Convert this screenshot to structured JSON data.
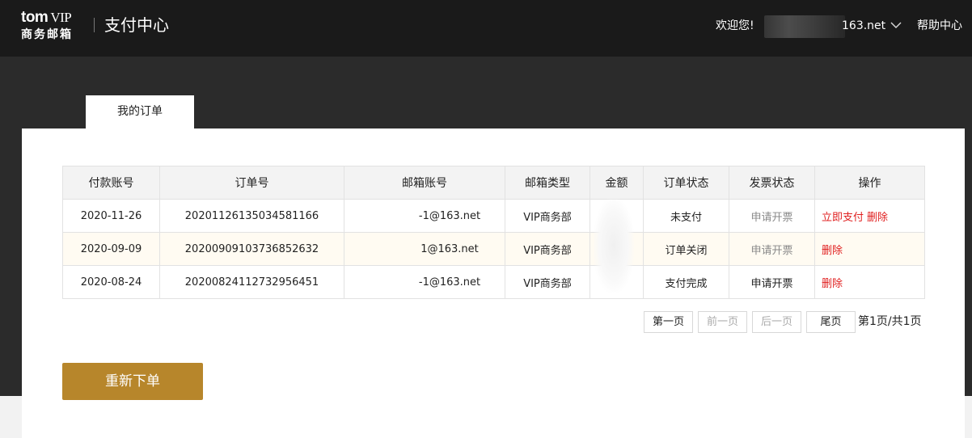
{
  "header": {
    "logo_line1": "tom",
    "logo_line1_vip": "VIP",
    "logo_line2": "商务邮箱",
    "site_title": "支付中心",
    "welcome": "欢迎您!",
    "account_suffix": "163.net",
    "help": "帮助中心"
  },
  "tabs": [
    {
      "label": "我的订单",
      "active": true
    }
  ],
  "table": {
    "columns": [
      "付款账号",
      "订单号",
      "邮箱账号",
      "邮箱类型",
      "金额",
      "订单状态",
      "发票状态",
      "操作"
    ],
    "rows": [
      {
        "pay_account": "2020-11-26",
        "order_no": "20201126135034581166",
        "email": "-1@163.net",
        "mailbox_type": "VIP商务部",
        "amount": "",
        "order_status": "未支付",
        "invoice_status": "申请开票",
        "actions": [
          "立即支付",
          "删除"
        ]
      },
      {
        "pay_account": "2020-09-09",
        "order_no": "20200909103736852632",
        "email": "1@163.net",
        "mailbox_type": "VIP商务部",
        "amount": "",
        "order_status": "订单关闭",
        "invoice_status": "申请开票",
        "actions": [
          "删除"
        ]
      },
      {
        "pay_account": "2020-08-24",
        "order_no": "20200824112732956451",
        "email": "-1@163.net",
        "mailbox_type": "VIP商务部",
        "amount": "",
        "order_status": "支付完成",
        "invoice_status": "申请开票",
        "actions": [
          "删除"
        ]
      }
    ]
  },
  "pagination": {
    "first": "第一页",
    "prev": "前一页",
    "next": "后一页",
    "last": "尾页",
    "info": "第1页/共1页"
  },
  "reorder_button": "重新下单",
  "colors": {
    "header_bg": "#1a1a1a",
    "band_bg": "#2b2b2b",
    "accent_gold": "#b7862b",
    "link_red": "#e02020"
  }
}
